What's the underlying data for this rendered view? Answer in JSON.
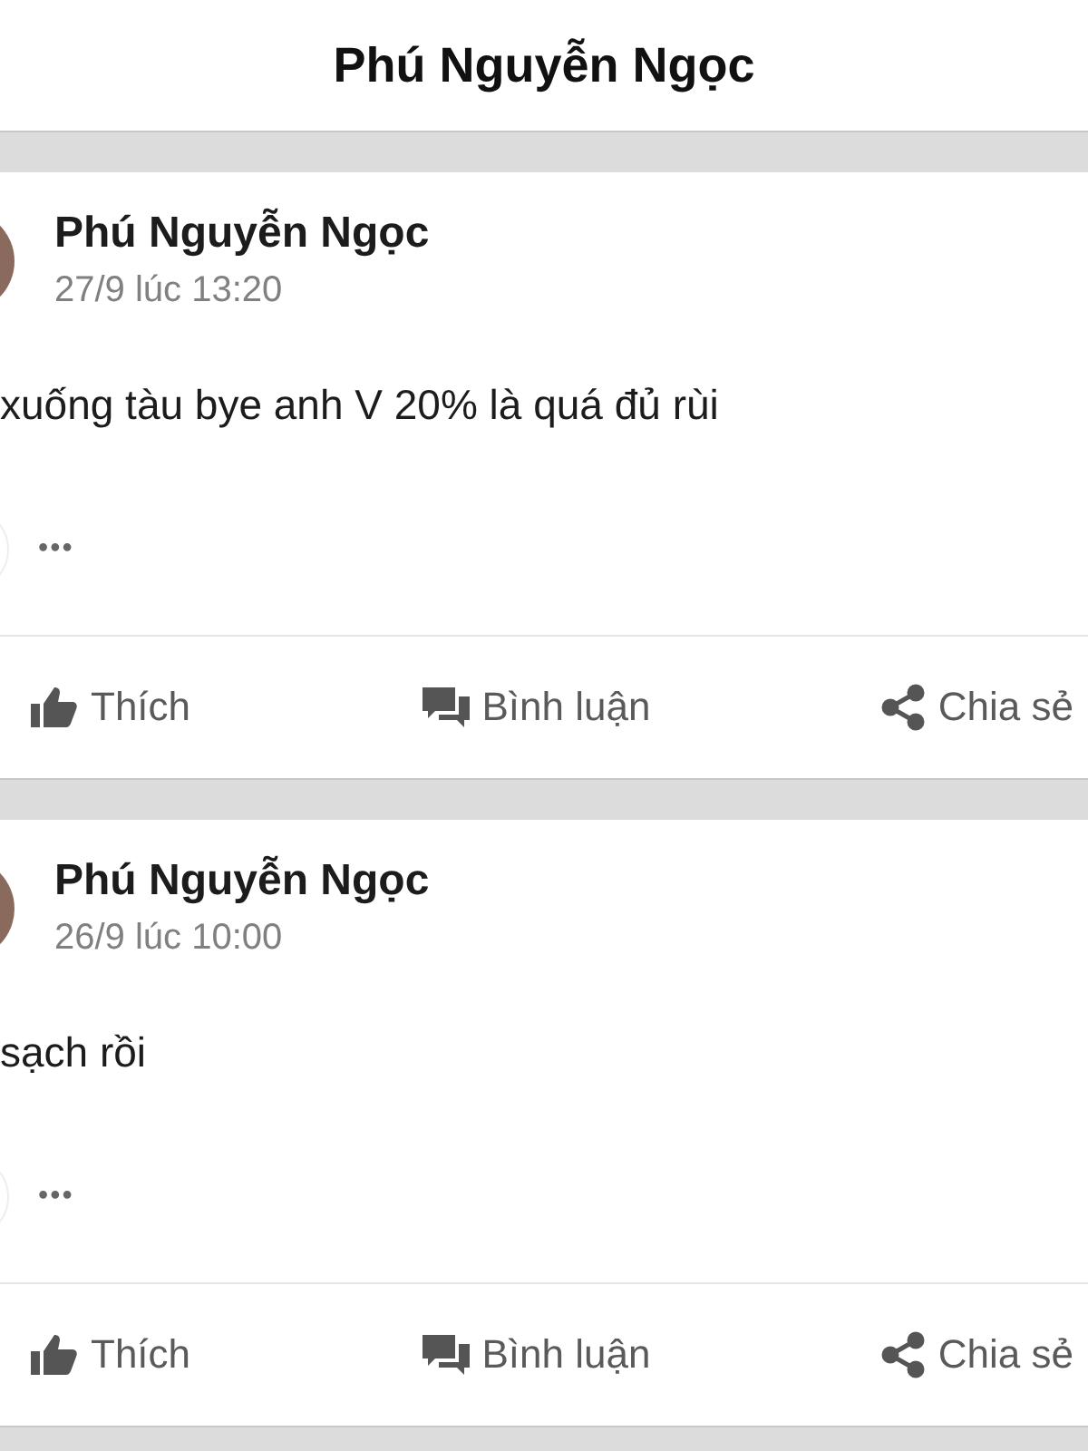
{
  "header": {
    "title": "Phú Nguyễn Ngọc"
  },
  "posts": [
    {
      "author": "Phú Nguyễn Ngọc",
      "time": "27/9 lúc 13:20",
      "text": "xuống tàu bye anh V 20% là quá đủ rùi",
      "more": "•••",
      "actions": [
        {
          "kind": "like",
          "label": "Thích"
        },
        {
          "kind": "comment",
          "label": "Bình luận"
        },
        {
          "kind": "share",
          "label": "Chia sẻ"
        }
      ]
    },
    {
      "author": "Phú Nguyễn Ngọc",
      "time": "26/9 lúc 10:00",
      "text": "sạch rồi",
      "more": "•••",
      "actions": [
        {
          "kind": "like",
          "label": "Thích"
        },
        {
          "kind": "comment",
          "label": "Bình luận"
        },
        {
          "kind": "share",
          "label": "Chia sẻ"
        }
      ]
    }
  ]
}
